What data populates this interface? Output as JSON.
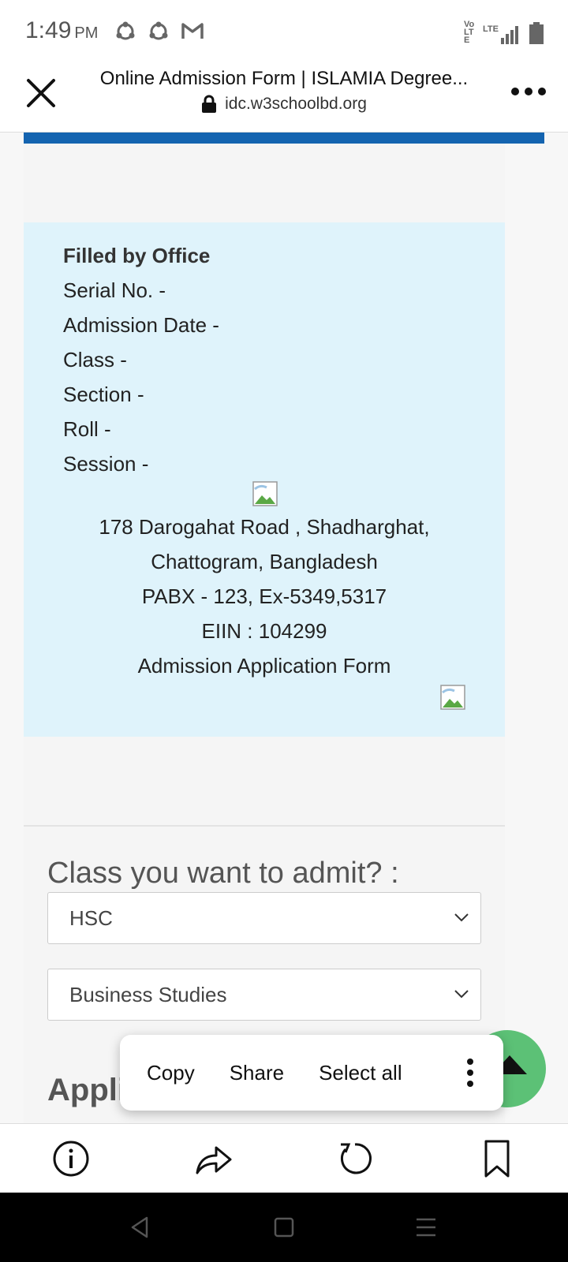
{
  "status_bar": {
    "time": "1:49",
    "ampm": "PM",
    "left_icons": [
      "sync-icon",
      "sync-icon",
      "gmail-icon"
    ],
    "right_labels": {
      "volte": "Vo LTE",
      "lte": "LTE"
    },
    "right_icons": [
      "signal-icon",
      "battery-icon"
    ]
  },
  "browser": {
    "title": "Online Admission Form | ISLAMIA Degree...",
    "url": "idc.w3schoolbd.org",
    "close_icon": "close-icon",
    "menu_icon": "more-horizontal-icon",
    "lock_icon": "lock-icon"
  },
  "office": {
    "heading": "Filled by Office",
    "fields": [
      "Serial No. -",
      "Admission Date -",
      "Class -",
      "Section -",
      "Roll -",
      "Session -"
    ]
  },
  "address": {
    "line1": "178 Darogahat Road , Shadharghat,",
    "line2": "Chattogram, Bangladesh",
    "line3": "PABX - 123, Ex-5349,5317",
    "line4": "EIIN : 104299",
    "line5": "Admission Application Form"
  },
  "form": {
    "class_question": "Class you want to admit? :",
    "class_select": "HSC",
    "group_select": "Business Studies",
    "next_heading_partial": "Appli"
  },
  "context_menu": {
    "copy": "Copy",
    "share": "Share",
    "select_all": "Select all",
    "more_icon": "more-vertical-icon"
  },
  "toolbar": {
    "icons": [
      "info-icon",
      "share-icon",
      "refresh-icon",
      "bookmark-icon"
    ]
  },
  "nav": {
    "icons": [
      "back-icon",
      "home-icon",
      "recents-icon"
    ]
  },
  "colors": {
    "brand_strip": "#1464b0",
    "office_bg": "#dff3fb",
    "fab": "#5cc176"
  }
}
